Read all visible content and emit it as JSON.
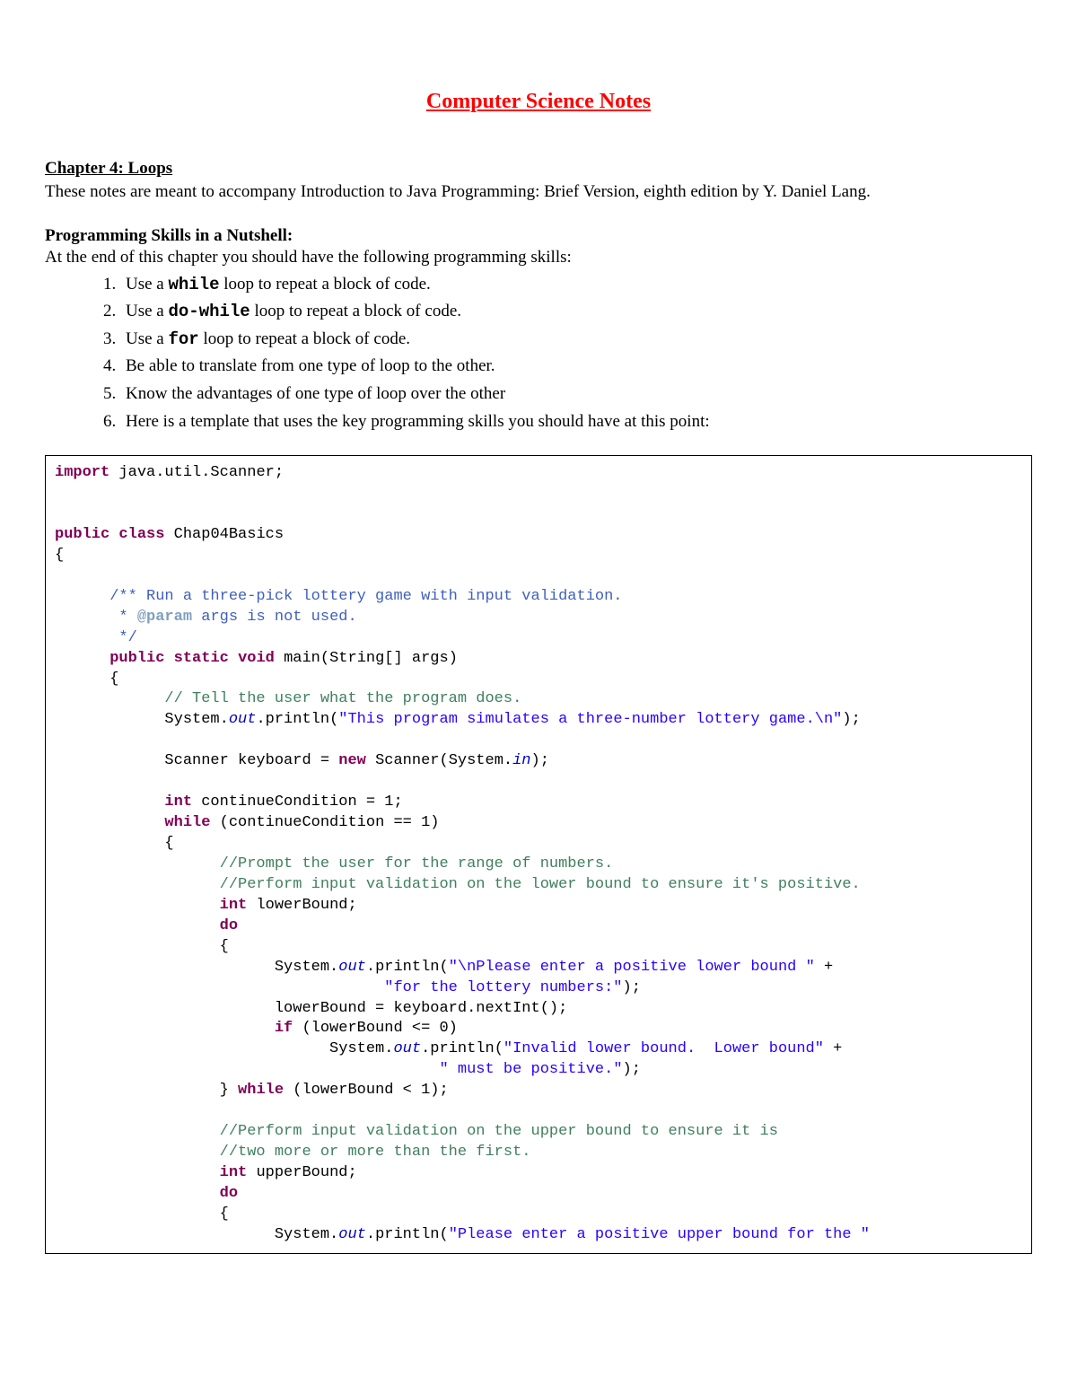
{
  "title": "Computer Science Notes",
  "chapter_heading": "Chapter 4: Loops",
  "intro_text": "These notes are meant to accompany Introduction to Java Programming: Brief Version, eighth edition by Y. Daniel Lang.",
  "section_heading": "Programming Skills in a Nutshell:",
  "section_intro": "At the end of this chapter you should have the following programming skills:",
  "skills": {
    "item1_a": "Use a ",
    "item1_b": "while",
    "item1_c": " loop to repeat a block of code.",
    "item2_a": "Use a ",
    "item2_b": "do-while",
    "item2_c": " loop to repeat a block of code.",
    "item3_a": "Use a ",
    "item3_b": "for",
    "item3_c": " loop to repeat a block of code.",
    "item4": "Be able to translate from one type of loop to the other.",
    "item5": "Know the advantages of one type of loop over the other",
    "item6": "Here is a template that uses the key programming skills you should have at this point:"
  },
  "code": {
    "l01_kw": "import",
    "l01_rest": " java.util.Scanner;",
    "l02_kw1": "public",
    "l02_kw2": "class",
    "l02_rest": " Chap04Basics",
    "l03": "{",
    "l04_doc": "      /** Run a three-pick lottery game with input validation.",
    "l05_doc_a": "       * ",
    "l05_doc_tag": "@param",
    "l05_doc_b": " args is not used.",
    "l06_doc": "       */",
    "l07_pad": "      ",
    "l07_kw1": "public",
    "l07_kw2": "static",
    "l07_kw3": "void",
    "l07_rest": " main(String[] args)",
    "l08": "      {",
    "l09_com": "            // Tell the user what the program does.",
    "l10_a": "            System.",
    "l10_out": "out",
    "l10_b": ".println(",
    "l10_str": "\"This program simulates a three-number lottery game.\\n\"",
    "l10_c": ");",
    "l11_a": "            Scanner keyboard = ",
    "l11_kw": "new",
    "l11_b": " Scanner(System.",
    "l11_in": "in",
    "l11_c": ");",
    "l12_pad": "            ",
    "l12_kw": "int",
    "l12_rest": " continueCondition = 1;",
    "l13_pad": "            ",
    "l13_kw": "while",
    "l13_rest": " (continueCondition == 1)",
    "l14": "            {",
    "l15_com": "                  //Prompt the user for the range of numbers.",
    "l16_com": "                  //Perform input validation on the lower bound to ensure it's positive.",
    "l17_pad": "                  ",
    "l17_kw": "int",
    "l17_rest": " lowerBound;",
    "l18_pad": "                  ",
    "l18_kw": "do",
    "l19": "                  {",
    "l20_a": "                        System.",
    "l20_out": "out",
    "l20_b": ".println(",
    "l20_str": "\"\\nPlease enter a positive lower bound \"",
    "l20_c": " +",
    "l21_pad": "                                    ",
    "l21_str": "\"for the lottery numbers:\"",
    "l21_c": ");",
    "l22": "                        lowerBound = keyboard.nextInt();",
    "l23_pad": "                        ",
    "l23_kw": "if",
    "l23_rest": " (lowerBound <= 0)",
    "l24_a": "                              System.",
    "l24_out": "out",
    "l24_b": ".println(",
    "l24_str": "\"Invalid lower bound.  Lower bound\"",
    "l24_c": " +",
    "l25_pad": "                                          ",
    "l25_str": "\" must be positive.\"",
    "l25_c": ");",
    "l26_a": "                  } ",
    "l26_kw": "while",
    "l26_rest": " (lowerBound < 1);",
    "l27_com": "                  //Perform input validation on the upper bound to ensure it is",
    "l28_com": "                  //two more or more than the first.",
    "l29_pad": "                  ",
    "l29_kw": "int",
    "l29_rest": " upperBound;",
    "l30_pad": "                  ",
    "l30_kw": "do",
    "l31": "                  {",
    "l32_a": "                        System.",
    "l32_out": "out",
    "l32_b": ".println(",
    "l32_str": "\"Please enter a positive upper bound for the \""
  }
}
